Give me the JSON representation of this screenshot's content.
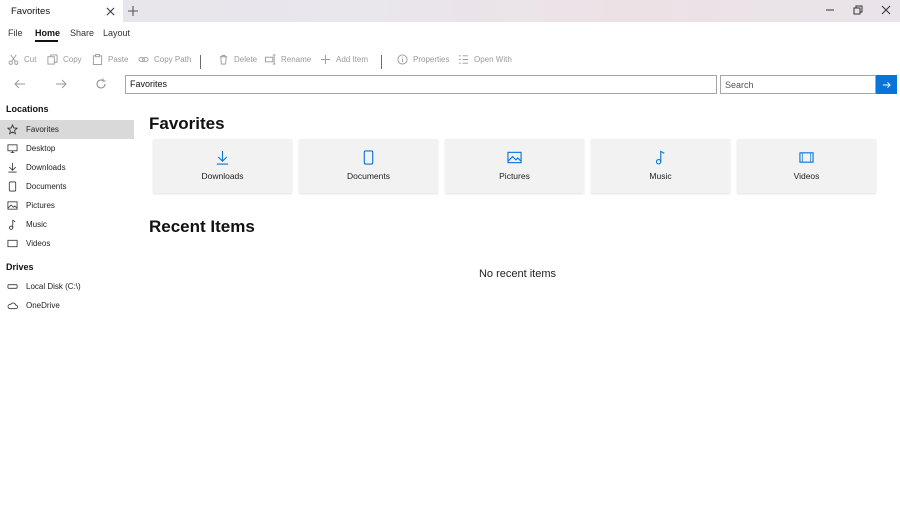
{
  "tab": {
    "title": "Favorites"
  },
  "menu": {
    "file": "File",
    "home": "Home",
    "share": "Share",
    "layout": "Layout"
  },
  "toolbar": {
    "cut": "Cut",
    "copy": "Copy",
    "paste": "Paste",
    "copy_path": "Copy Path",
    "delete": "Delete",
    "rename": "Rename",
    "add_item": "Add Item",
    "properties": "Properties",
    "open_with": "Open With"
  },
  "address": {
    "value": "Favorites"
  },
  "search": {
    "placeholder": "Search"
  },
  "sidebar": {
    "locations_heading": "Locations",
    "locations": [
      {
        "label": "Favorites",
        "icon": "star-icon"
      },
      {
        "label": "Desktop",
        "icon": "desktop-icon"
      },
      {
        "label": "Downloads",
        "icon": "download-icon"
      },
      {
        "label": "Documents",
        "icon": "document-icon"
      },
      {
        "label": "Pictures",
        "icon": "picture-icon"
      },
      {
        "label": "Music",
        "icon": "music-icon"
      },
      {
        "label": "Videos",
        "icon": "video-icon"
      }
    ],
    "drives_heading": "Drives",
    "drives": [
      {
        "label": "Local Disk (C:\\)",
        "icon": "drive-icon"
      },
      {
        "label": "OneDrive",
        "icon": "cloud-icon"
      }
    ]
  },
  "main": {
    "favorites_title": "Favorites",
    "cards": [
      {
        "label": "Downloads",
        "icon": "download-icon"
      },
      {
        "label": "Documents",
        "icon": "document-icon"
      },
      {
        "label": "Pictures",
        "icon": "picture-icon"
      },
      {
        "label": "Music",
        "icon": "music-icon"
      },
      {
        "label": "Videos",
        "icon": "video-icon"
      }
    ],
    "recent_title": "Recent Items",
    "recent_empty": "No recent items"
  },
  "colors": {
    "accent": "#0a74d9",
    "selected": "#d9d9d9",
    "card": "#f2f2f2",
    "disabled": "#9a9a9a"
  }
}
